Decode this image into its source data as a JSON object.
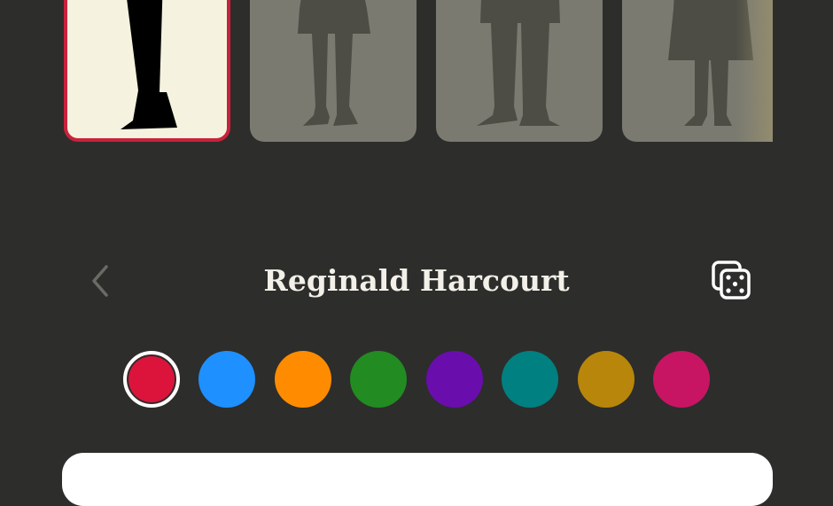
{
  "character": {
    "name": "Reginald Harcourt"
  },
  "cards": [
    {
      "label": "figure-dark-trousers",
      "selected": true
    },
    {
      "label": "figure-coat-heels",
      "selected": false
    },
    {
      "label": "figure-suit",
      "selected": false
    },
    {
      "label": "figure-long-coat",
      "selected": false
    }
  ],
  "colors": {
    "background": "#2d2d2b",
    "selected_border": "#c9213c",
    "card_selected_bg": "#f5f3df",
    "card_bg": "#7a7a70",
    "silhouette": "#4d4d45"
  },
  "swatches": [
    {
      "name": "crimson",
      "hex": "#dc143c",
      "selected": true
    },
    {
      "name": "blue",
      "hex": "#1e90ff",
      "selected": false
    },
    {
      "name": "orange",
      "hex": "#ff8c00",
      "selected": false
    },
    {
      "name": "green",
      "hex": "#228b22",
      "selected": false
    },
    {
      "name": "purple",
      "hex": "#6a0dad",
      "selected": false
    },
    {
      "name": "teal",
      "hex": "#008080",
      "selected": false
    },
    {
      "name": "goldenrod",
      "hex": "#b8860b",
      "selected": false
    },
    {
      "name": "magenta",
      "hex": "#c71563",
      "selected": false
    }
  ],
  "icons": {
    "back": "chevron-left-icon",
    "randomize": "dice-icon"
  }
}
